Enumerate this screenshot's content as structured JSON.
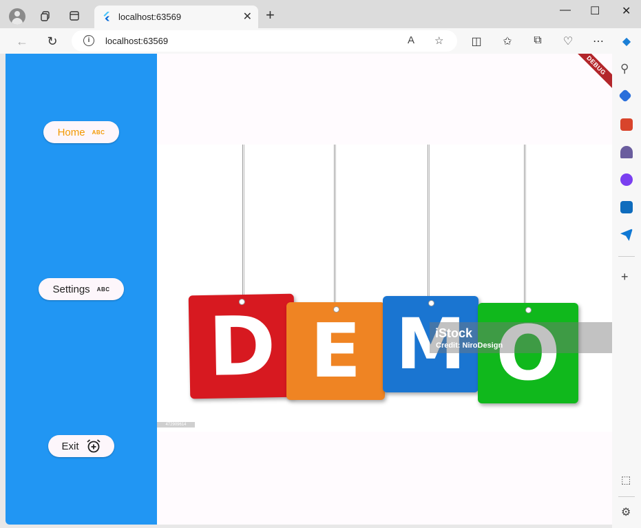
{
  "browser": {
    "tab_title": "localhost:63569",
    "url": "localhost:63569",
    "new_tab_symbol": "+",
    "close_tab_symbol": "✕"
  },
  "sidebar": {
    "items": [
      {
        "label": "Home",
        "trail": "ABC",
        "color": "#f29900"
      },
      {
        "label": "Settings",
        "trail": "ABC",
        "color": "#222222"
      },
      {
        "label": "Exit",
        "trail": "alarm-add-icon",
        "color": "#222222"
      }
    ],
    "background": "#2196f3"
  },
  "content": {
    "letters": [
      "D",
      "E",
      "M",
      "O"
    ],
    "letter_colors": [
      "#d71920",
      "#ef8423",
      "#1a75d1",
      "#10b81c"
    ],
    "watermark_brand": "iStock",
    "watermark_credit": "Credit: NiroDesign",
    "image_id": "472909614"
  },
  "banner": {
    "debug": "DEBUG"
  }
}
